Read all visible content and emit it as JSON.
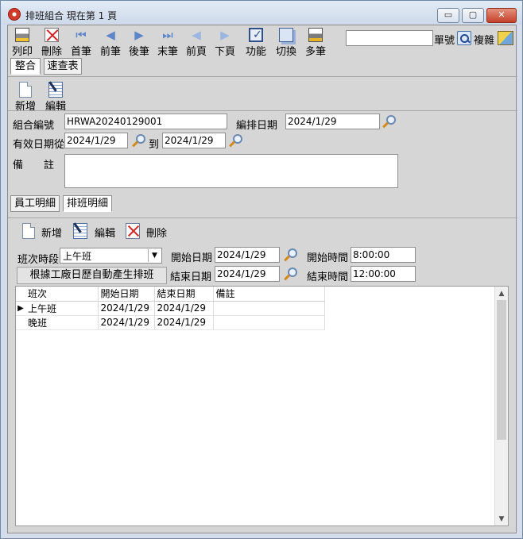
{
  "window": {
    "title": "排班組合  現在第 1 頁",
    "min_label": "▭",
    "max_label": "▢",
    "close_label": "✕"
  },
  "toolbar": {
    "print": "列印",
    "delete": "刪除",
    "first": "首筆",
    "prev": "前筆",
    "next": "後筆",
    "last": "末筆",
    "prev_page": "前頁",
    "next_page": "下頁",
    "function": "功能",
    "switch": "切換",
    "multi": "多筆",
    "search_value": "",
    "unit_label": "單號",
    "copy_label": "複雜"
  },
  "view_tabs": {
    "combined": "整合",
    "quick_lookup": "速查表"
  },
  "record_actions": {
    "add": "新增",
    "edit": "編輯"
  },
  "form": {
    "group_code_label": "組合編號",
    "group_code_value": "HRWA20240129001",
    "schedule_date_label": "編排日期",
    "schedule_date_value": "2024/1/29",
    "valid_from_label": "有效日期從",
    "valid_from_value": "2024/1/29",
    "to_label": "到",
    "valid_to_value": "2024/1/29",
    "note_label": "備　　註",
    "note_value": ""
  },
  "detail_tabs": {
    "employees": "員工明細",
    "shifts": "排班明細"
  },
  "detail_actions": {
    "add": "新增",
    "edit": "編輯",
    "delete": "刪除"
  },
  "shift_form": {
    "period_label": "班次時段",
    "period_value": "上午班",
    "start_date_label": "開始日期",
    "start_date_value": "2024/1/29",
    "start_time_label": "開始時間",
    "start_time_value": "8:00:00",
    "auto_button": "根據工廠日歷自動產生排班",
    "end_date_label": "結束日期",
    "end_date_value": "2024/1/29",
    "end_time_label": "結束時間",
    "end_time_value": "12:00:00"
  },
  "grid": {
    "columns": [
      "班次",
      "開始日期",
      "結束日期",
      "備註"
    ],
    "rows": [
      {
        "indicator": "▶",
        "cells": [
          "上午班",
          "2024/1/29",
          "2024/1/29",
          ""
        ]
      },
      {
        "indicator": "",
        "cells": [
          "晚班",
          "2024/1/29",
          "2024/1/29",
          ""
        ]
      }
    ]
  },
  "colors": {
    "accent": "#5f86c8",
    "window_border": "#6f8aa8",
    "close_button": "#c4412a"
  }
}
